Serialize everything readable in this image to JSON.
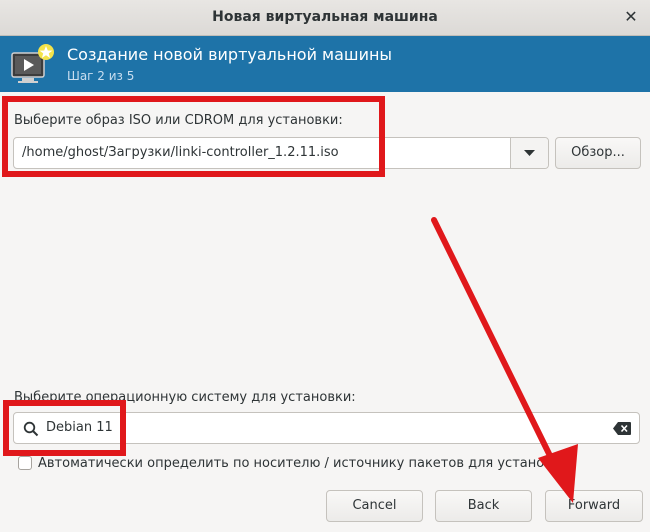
{
  "window": {
    "title": "Новая виртуальная машина",
    "close_glyph": "✕"
  },
  "header": {
    "title": "Создание новой виртуальной машины",
    "subtitle": "Шаг 2 из 5",
    "icon": "vm-monitor-icon",
    "accent": "#1e73a8"
  },
  "iso": {
    "label": "Выберите образ ISO или CDROM для установки:",
    "value": "/home/ghost/Загрузки/linki-controller_1.2.11.iso",
    "browse_label": "Обзор..."
  },
  "os": {
    "label": "Выберите операционную систему для установки:",
    "value": "Debian 11",
    "auto_detect_label": "Автоматически определить по носителю / источнику пакетов для установки",
    "auto_detect_checked": false
  },
  "buttons": {
    "cancel": "Cancel",
    "back": "Back",
    "forward": "Forward"
  },
  "annotation": {
    "color": "#e0181b"
  }
}
